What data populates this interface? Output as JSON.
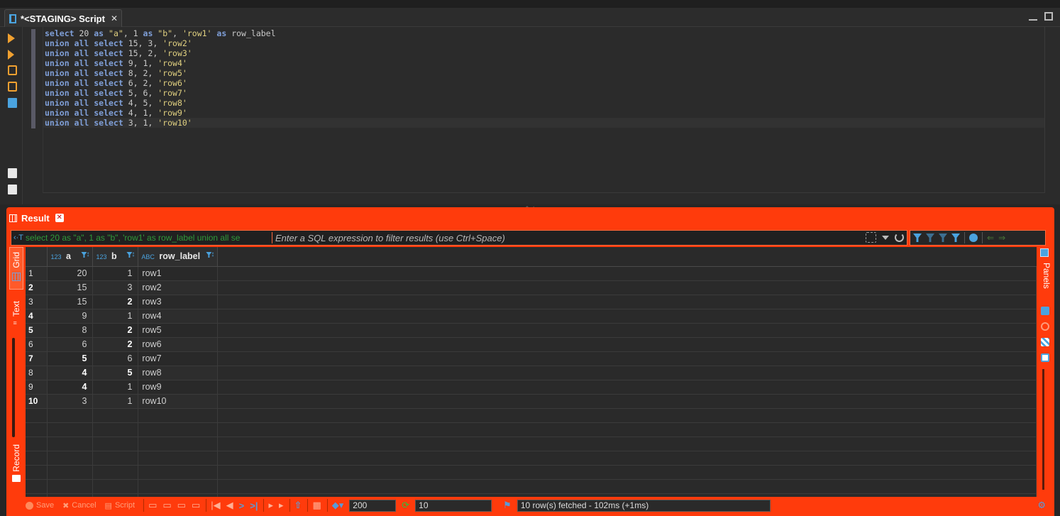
{
  "editor_tab": {
    "title": "*<STAGING> Script",
    "close": "✕"
  },
  "code_lines": [
    [
      {
        "k": "kw",
        "t": "select"
      },
      {
        "k": "num",
        "t": " 20 "
      },
      {
        "k": "kw",
        "t": "as"
      },
      {
        "k": "str",
        "t": " \"a\""
      },
      {
        "k": "",
        "t": ", 1 "
      },
      {
        "k": "kw",
        "t": "as"
      },
      {
        "k": "str",
        "t": " \"b\""
      },
      {
        "k": "",
        "t": ", "
      },
      {
        "k": "str",
        "t": "'row1'"
      },
      {
        "k": "",
        "t": " "
      },
      {
        "k": "kw",
        "t": "as"
      },
      {
        "k": "",
        "t": " row_label"
      }
    ],
    [
      {
        "k": "kw",
        "t": "union all select"
      },
      {
        "k": "",
        "t": " 15, 3, "
      },
      {
        "k": "str",
        "t": "'row2'"
      }
    ],
    [
      {
        "k": "kw",
        "t": "union all select"
      },
      {
        "k": "",
        "t": " 15, 2, "
      },
      {
        "k": "str",
        "t": "'row3'"
      }
    ],
    [
      {
        "k": "kw",
        "t": "union all select"
      },
      {
        "k": "",
        "t": " 9, 1, "
      },
      {
        "k": "str",
        "t": "'row4'"
      }
    ],
    [
      {
        "k": "kw",
        "t": "union all select"
      },
      {
        "k": "",
        "t": " 8, 2, "
      },
      {
        "k": "str",
        "t": "'row5'"
      }
    ],
    [
      {
        "k": "kw",
        "t": "union all select"
      },
      {
        "k": "",
        "t": " 6, 2, "
      },
      {
        "k": "str",
        "t": "'row6'"
      }
    ],
    [
      {
        "k": "kw",
        "t": "union all select"
      },
      {
        "k": "",
        "t": " 5, 6, "
      },
      {
        "k": "str",
        "t": "'row7'"
      }
    ],
    [
      {
        "k": "kw",
        "t": "union all select"
      },
      {
        "k": "",
        "t": " 4, 5, "
      },
      {
        "k": "str",
        "t": "'row8'"
      }
    ],
    [
      {
        "k": "kw",
        "t": "union all select"
      },
      {
        "k": "",
        "t": " 4, 1, "
      },
      {
        "k": "str",
        "t": "'row9'"
      }
    ],
    [
      {
        "k": "kw",
        "t": "union all select"
      },
      {
        "k": "",
        "t": " 3, 1, "
      },
      {
        "k": "str",
        "t": "'row10'"
      }
    ]
  ],
  "result": {
    "tab_label": "Result",
    "filter_prefix_icon": "‹·T",
    "query_preview": "select 20 as \"a\", 1 as \"b\", 'row1' as row_label union all se",
    "filter_placeholder": "Enter a SQL expression to filter results (use Ctrl+Space)",
    "vertical_tabs": {
      "grid": "Grid",
      "text": "Text",
      "record": "Record"
    },
    "panels_label": "Panels",
    "columns": [
      {
        "type": "123",
        "name": "a"
      },
      {
        "type": "123",
        "name": "b"
      },
      {
        "type": "ABC",
        "name": "row_label"
      }
    ],
    "rows": [
      {
        "n": "1",
        "a": "20",
        "b": "1",
        "label": "row1",
        "bold": false,
        "a_bold": false,
        "b_bold": false
      },
      {
        "n": "2",
        "a": "15",
        "b": "3",
        "label": "row2",
        "bold": true,
        "a_bold": false,
        "b_bold": false
      },
      {
        "n": "3",
        "a": "15",
        "b": "2",
        "label": "row3",
        "bold": false,
        "a_bold": false,
        "b_bold": true
      },
      {
        "n": "4",
        "a": "9",
        "b": "1",
        "label": "row4",
        "bold": true,
        "a_bold": false,
        "b_bold": false
      },
      {
        "n": "5",
        "a": "8",
        "b": "2",
        "label": "row5",
        "bold": true,
        "a_bold": false,
        "b_bold": true
      },
      {
        "n": "6",
        "a": "6",
        "b": "2",
        "label": "row6",
        "bold": false,
        "a_bold": false,
        "b_bold": true
      },
      {
        "n": "7",
        "a": "5",
        "b": "6",
        "label": "row7",
        "bold": true,
        "a_bold": true,
        "b_bold": false
      },
      {
        "n": "8",
        "a": "4",
        "b": "5",
        "label": "row8",
        "bold": false,
        "a_bold": true,
        "b_bold": true
      },
      {
        "n": "9",
        "a": "4",
        "b": "1",
        "label": "row9",
        "bold": false,
        "a_bold": true,
        "b_bold": false
      },
      {
        "n": "10",
        "a": "3",
        "b": "1",
        "label": "row10",
        "bold": true,
        "a_bold": false,
        "b_bold": false
      }
    ],
    "bottom": {
      "save": "Save",
      "cancel": "Cancel",
      "script": "Script",
      "fetch_size": "200",
      "row_count": "10",
      "status": "10 row(s) fetched - 102ms (+1ms)"
    }
  },
  "colors": {
    "accent": "#ff3b0c",
    "keyword": "#7f9fd8",
    "string": "#e0d080",
    "link": "#4aa3df"
  }
}
